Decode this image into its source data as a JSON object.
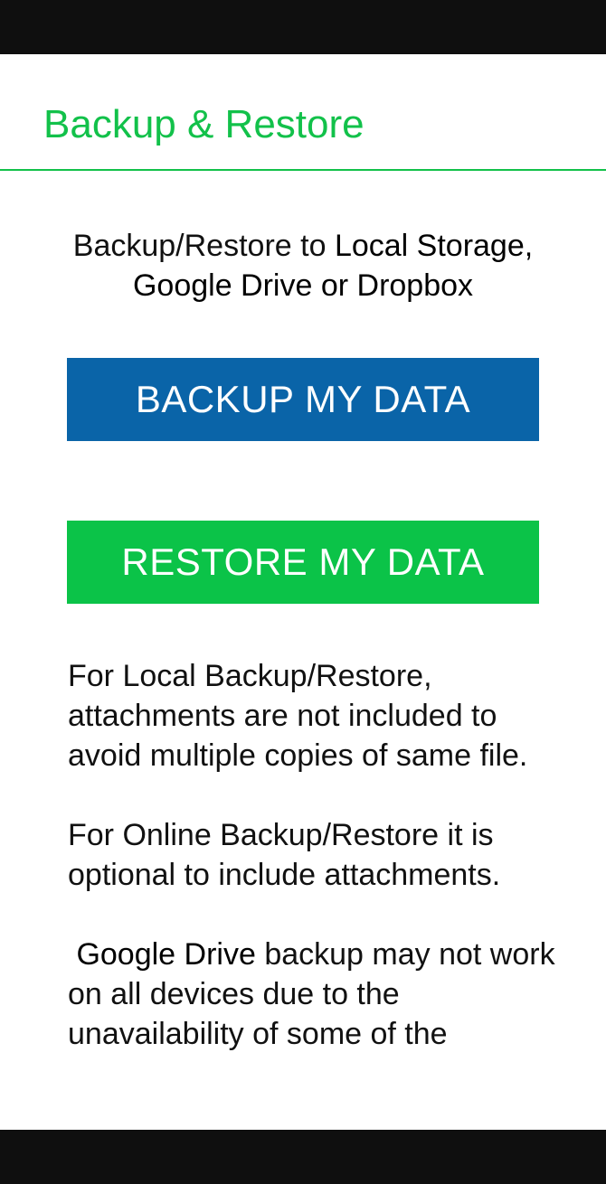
{
  "header": {
    "title": "Backup & Restore"
  },
  "intro": {
    "prefix": "Backup/Restore to ",
    "bold": "Local Storage, Google Drive or Dropbox"
  },
  "buttons": {
    "backup_label": "BACKUP MY DATA",
    "restore_label": "RESTORE MY DATA"
  },
  "info": {
    "local_note": "For Local Backup/Restore, attachments are not included to avoid multiple copies of same file.",
    "online_note": "For Online Backup/Restore it is optional to include attachments.",
    "gdrive_bold": "Google Drive",
    "gdrive_rest": " backup may not work on all devices due to the unavailability of some of the"
  },
  "colors": {
    "accent_green": "#12c14a",
    "backup_blue": "#0a64a8",
    "restore_green": "#0bc348"
  }
}
